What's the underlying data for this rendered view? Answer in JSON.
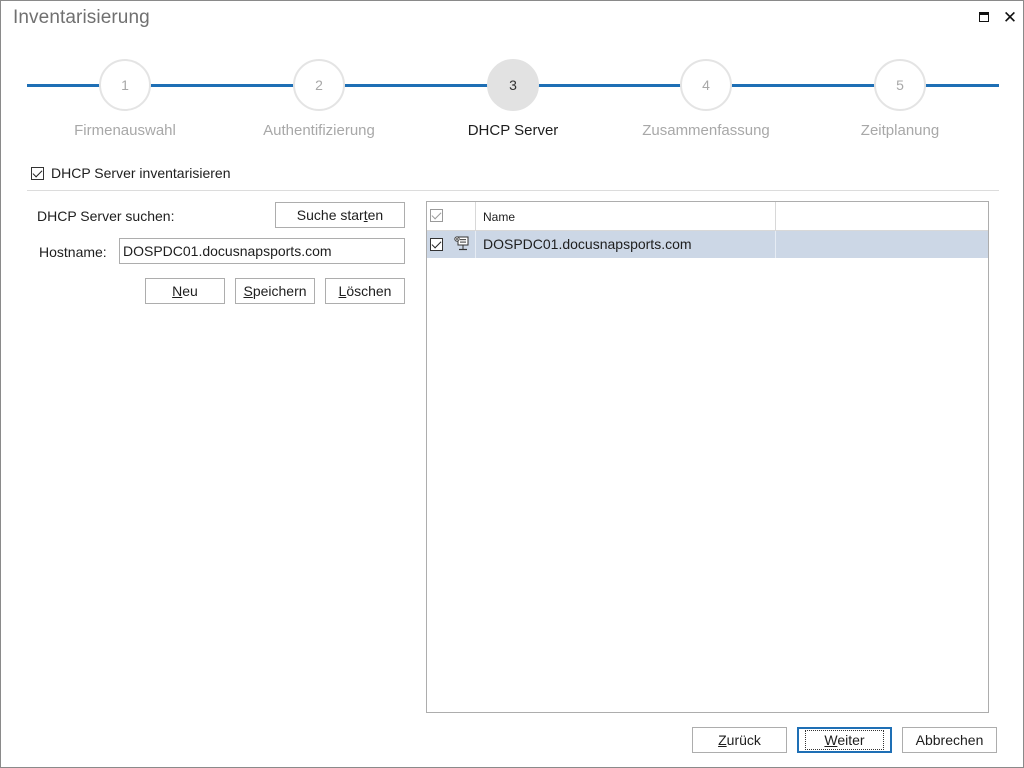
{
  "window": {
    "title": "Inventarisierung"
  },
  "steps": [
    {
      "number": "1",
      "label": "Firmenauswahl",
      "active": false
    },
    {
      "number": "2",
      "label": "Authentifizierung",
      "active": false
    },
    {
      "number": "3",
      "label": "DHCP Server",
      "active": true
    },
    {
      "number": "4",
      "label": "Zusammenfassung",
      "active": false
    },
    {
      "number": "5",
      "label": "Zeitplanung",
      "active": false
    }
  ],
  "inventory_checkbox": {
    "label": "DHCP Server inventarisieren",
    "checked": true
  },
  "search": {
    "label": "DHCP Server suchen:",
    "button_pre": "Suche star",
    "button_u": "t",
    "button_post": "en"
  },
  "hostname": {
    "label": "Hostname:",
    "value": "DOSPDC01.docusnapsports.com"
  },
  "actions": {
    "new_u": "N",
    "new_rest": "eu",
    "save_u": "S",
    "save_rest": "peichern",
    "delete_u": "L",
    "delete_rest": "öschen"
  },
  "grid": {
    "columns": [
      "Name"
    ],
    "rows": [
      {
        "name": "DOSPDC01.docusnapsports.com",
        "checked": true,
        "icon": "server-icon"
      }
    ]
  },
  "footer": {
    "back_u": "Z",
    "back_rest": "urück",
    "next_u": "W",
    "next_rest": "eiter",
    "cancel": "Abbrechen"
  },
  "colors": {
    "accent": "#1e6fb5",
    "row_selected": "#ccd7e6",
    "inactive_text": "#a8a8a8"
  }
}
